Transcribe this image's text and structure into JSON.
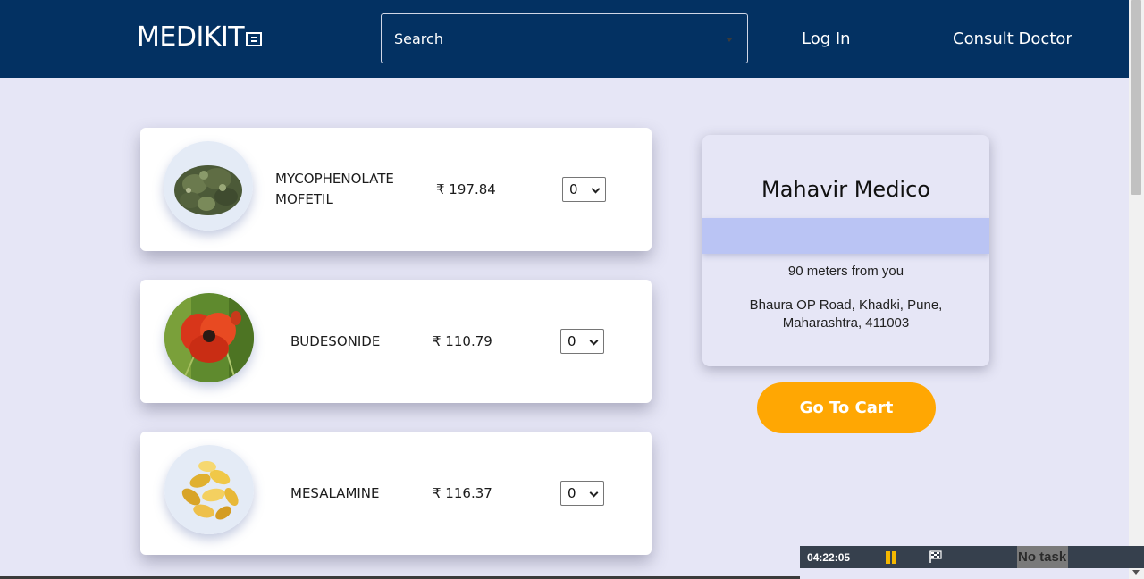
{
  "header": {
    "logo_text": "MEDIKIT",
    "search_placeholder": "Search",
    "login_label": "Log In",
    "consult_label": "Consult Doctor",
    "background_color": "#033162"
  },
  "products": [
    {
      "name_line1": "MYCOPHENOLATE",
      "name_line2": "MOFETIL",
      "price": "₹ 197.84",
      "quantity": "0",
      "image_icon": "herb-leaves-image"
    },
    {
      "name": "BUDESONIDE",
      "price": "₹ 110.79",
      "quantity": "0",
      "image_icon": "poppy-flower-image"
    },
    {
      "name": "MESALAMINE",
      "price": "₹ 116.37",
      "quantity": "0",
      "image_icon": "gel-capsules-image"
    }
  ],
  "store": {
    "name": "Mahavir Medico",
    "distance": "90 meters from you",
    "address": "Bhaura OP Road, Khadki, Pune, Maharashtra, 411003",
    "band_color": "#bac4f4"
  },
  "cart_button": {
    "label": "Go To Cart",
    "color": "#ffa703"
  },
  "taskbar": {
    "timer": "04:22:05",
    "task_label": "No task",
    "pause_icon": "pause-icon",
    "flag_icon": "flag-icon"
  }
}
